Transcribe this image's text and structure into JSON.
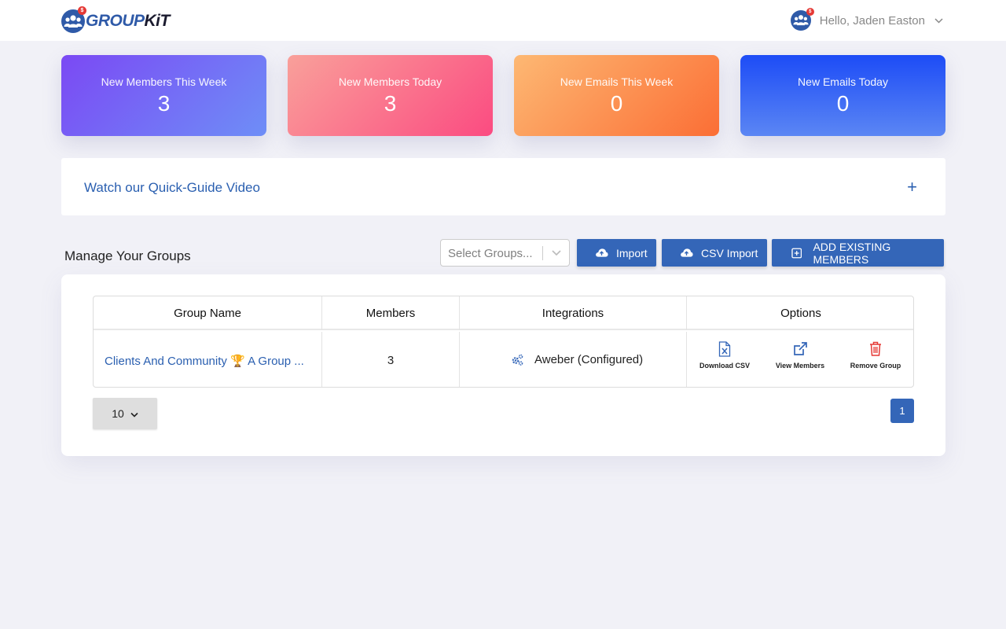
{
  "brand": {
    "name_part1": "GROUP",
    "name_part2": "KiT",
    "badge": "$"
  },
  "header": {
    "greeting": "Hello, Jaden Easton",
    "avatar_badge": "$"
  },
  "stats": [
    {
      "label": "New Members This Week",
      "value": "3"
    },
    {
      "label": "New Members Today",
      "value": "3"
    },
    {
      "label": "New Emails This Week",
      "value": "0"
    },
    {
      "label": "New Emails Today",
      "value": "0"
    }
  ],
  "guide": {
    "title": "Watch our Quick-Guide Video",
    "toggle": "+"
  },
  "manage": {
    "title": "Manage Your Groups",
    "select_placeholder": "Select Groups...",
    "import_label": "Import",
    "csv_import_label": "CSV Import",
    "add_existing_label": "ADD EXISTING MEMBERS"
  },
  "table": {
    "headers": [
      "Group Name",
      "Members",
      "Integrations",
      "Options"
    ],
    "rows": [
      {
        "group_name": "Clients And Community 🏆 A Group ...",
        "members": "3",
        "integration": "Aweber (Configured)",
        "options": [
          "Download CSV",
          "View Members",
          "Remove Group"
        ]
      }
    ]
  },
  "pagination": {
    "page_size": "10",
    "current_page": "1"
  },
  "colors": {
    "brand_blue": "#2f5aa8",
    "button_blue": "#3466b8",
    "link_blue": "#2a5fb0",
    "danger_red": "#e53935"
  }
}
